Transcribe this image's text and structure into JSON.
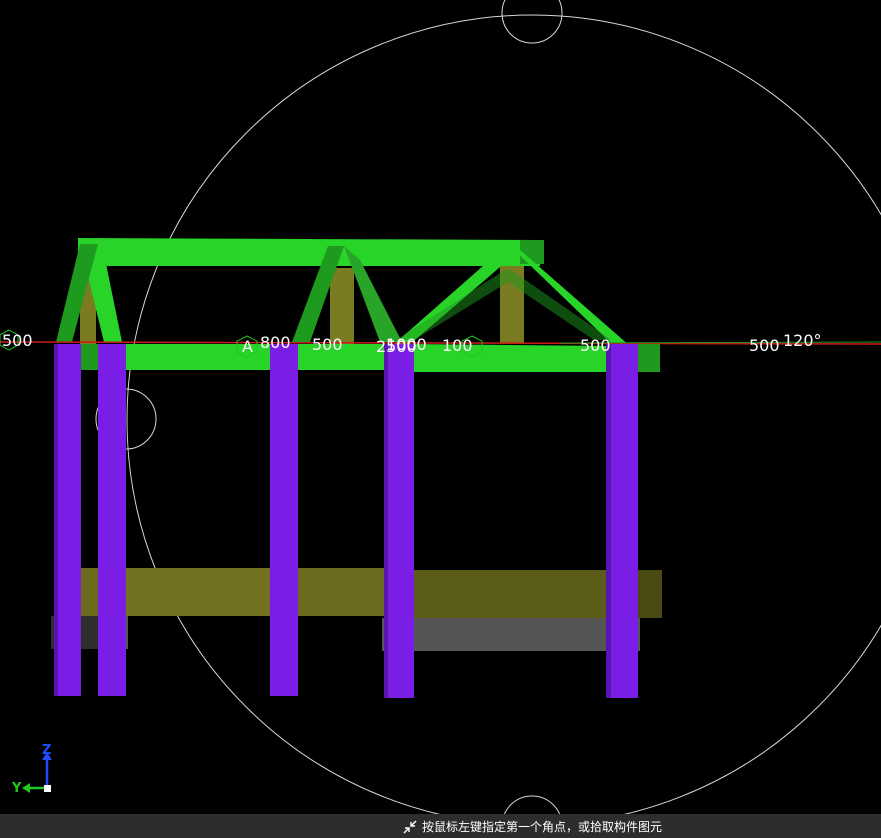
{
  "viewport": {
    "background_color": "#000000",
    "dimension_labels": [
      {
        "id": "dim-left-500",
        "text": "500"
      },
      {
        "id": "dim-grid-a",
        "text": "A"
      },
      {
        "id": "dim-800",
        "text": "800"
      },
      {
        "id": "dim-500-1",
        "text": "500"
      },
      {
        "id": "dim-2500",
        "text": "2500"
      },
      {
        "id": "dim-1000",
        "text": "1000"
      },
      {
        "id": "dim-100",
        "text": "100"
      },
      {
        "id": "dim-500-2",
        "text": "500"
      },
      {
        "id": "dim-500-3",
        "text": "500"
      },
      {
        "id": "dim-angle",
        "text": "120°"
      }
    ],
    "colors": {
      "beam": "#28d428",
      "beam_dark": "#1e9a1e",
      "column": "#7a1ee6",
      "slab": "#6b6b1e",
      "foundation": "#555555",
      "axis_line": "#cc1a1a",
      "orbit_circle": "#d8d8d8"
    }
  },
  "axis_indicator": {
    "z_label": "Z",
    "y_label": "Y",
    "z_color": "#1e4bff",
    "y_color": "#1ec81e"
  },
  "status_bar": {
    "icon": "pick-cursor-icon",
    "text": "按鼠标左键指定第一个角点，或拾取构件图元"
  }
}
